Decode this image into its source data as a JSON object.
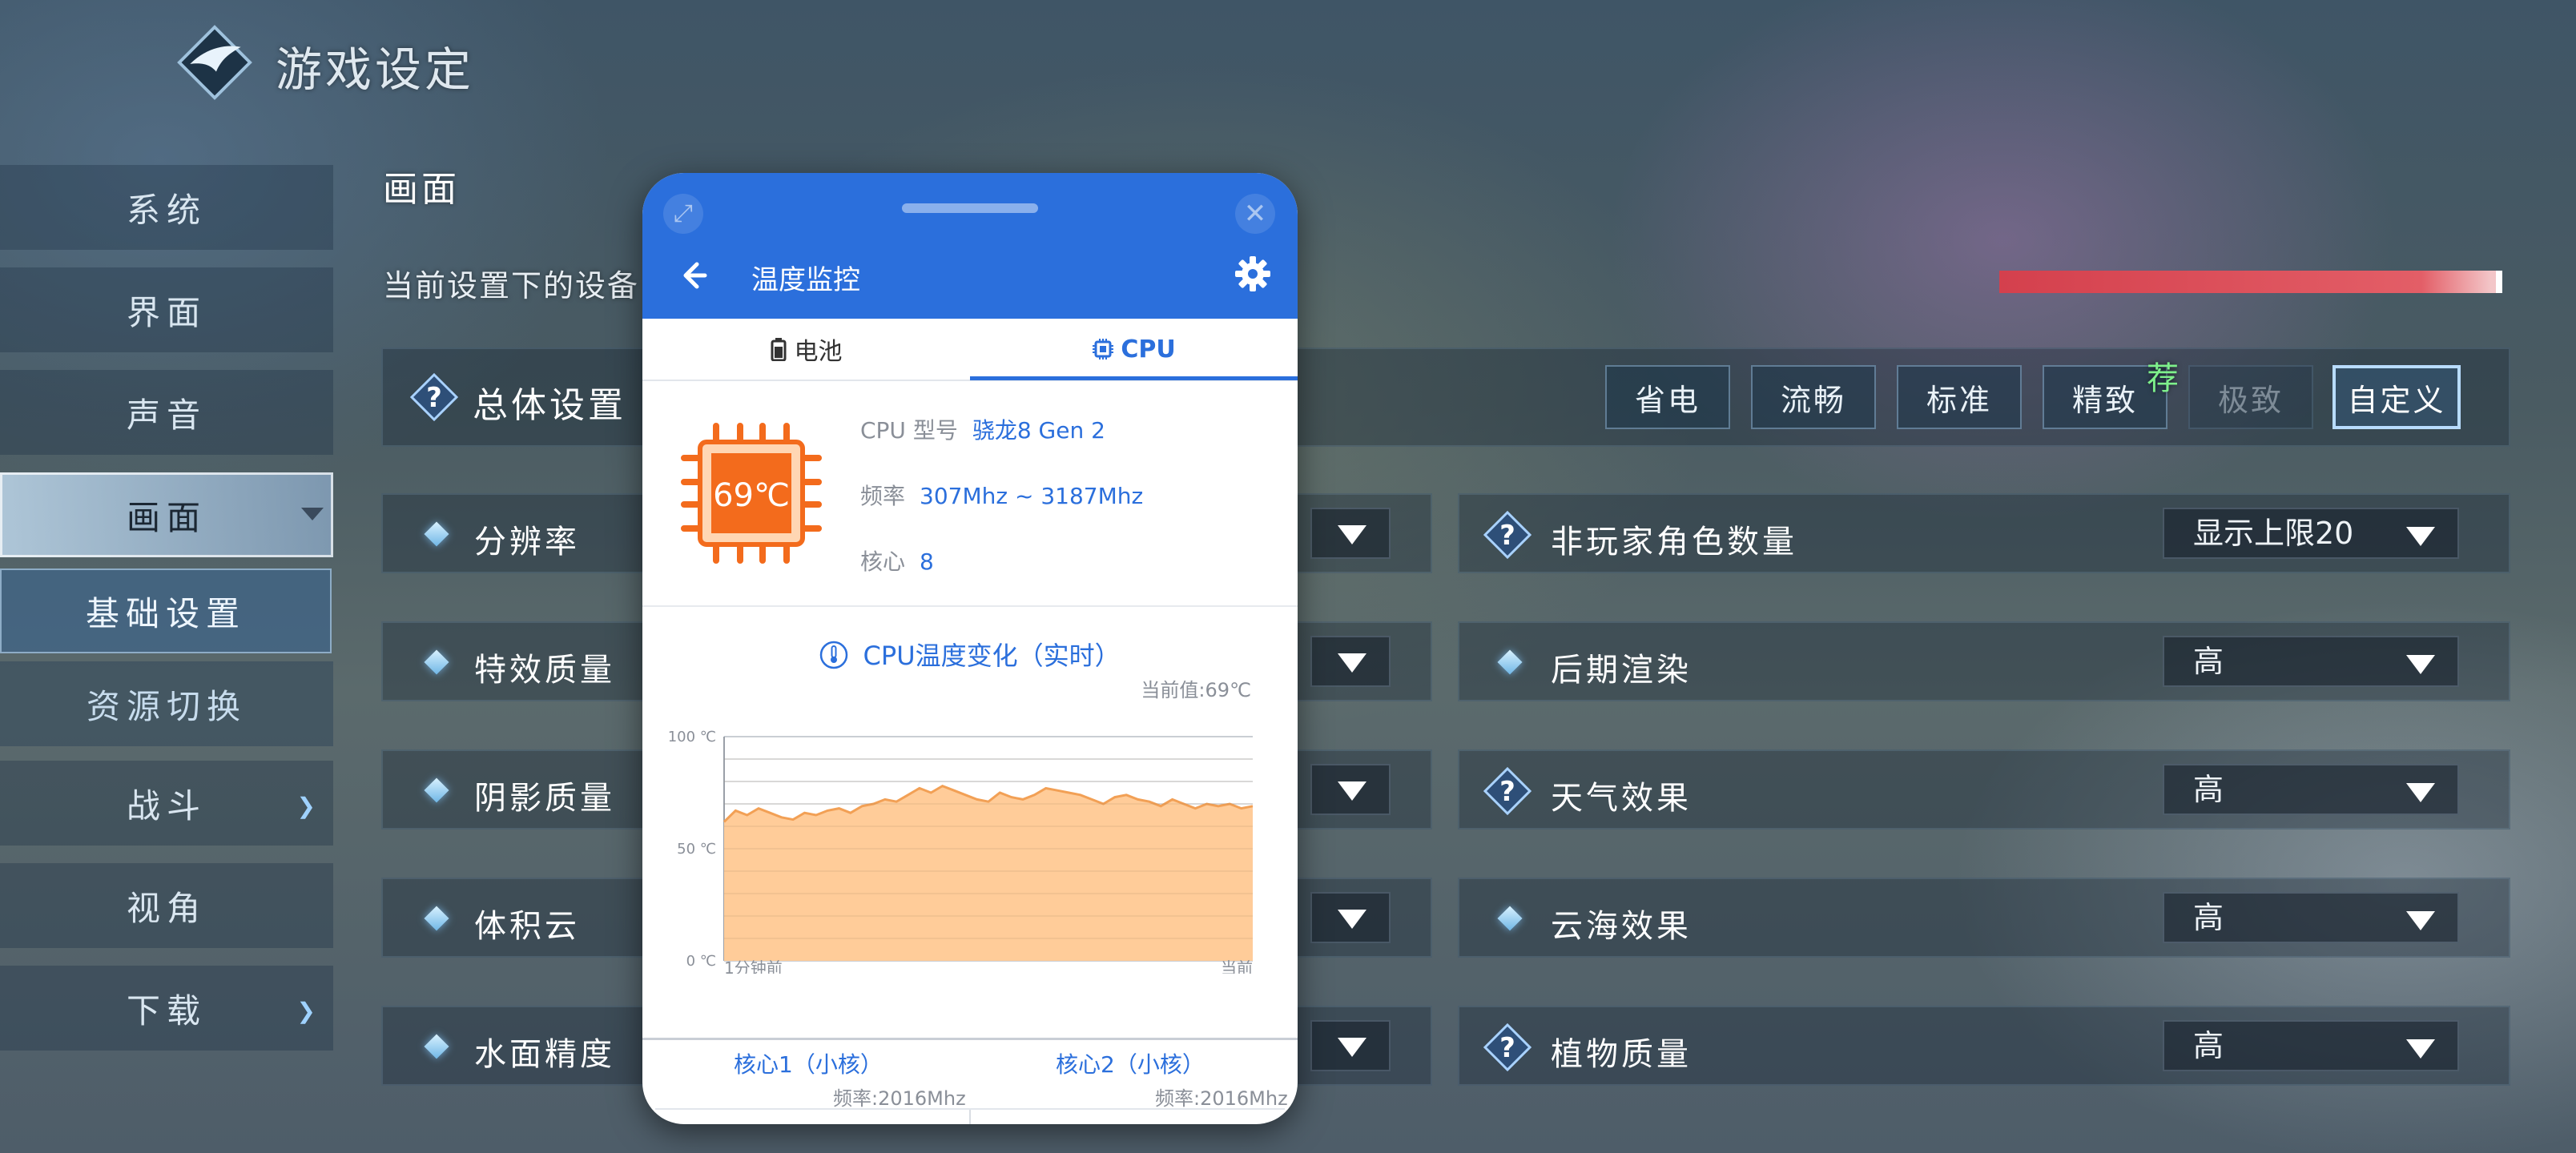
{
  "app": {
    "title": "游戏设定"
  },
  "sidebar": {
    "items": [
      {
        "label": "系统"
      },
      {
        "label": "界面"
      },
      {
        "label": "声音"
      },
      {
        "label": "画面"
      },
      {
        "label": "基础设置"
      },
      {
        "label": "资源切换"
      },
      {
        "label": "战斗"
      },
      {
        "label": "视角"
      },
      {
        "label": "下载"
      }
    ]
  },
  "main": {
    "section_title": "画面",
    "device_desc": "当前设置下的设备",
    "overall": {
      "label": "总体设置",
      "presets": [
        "省电",
        "流畅",
        "标准",
        "精致",
        "极致",
        "自定义"
      ],
      "selected": "自定义",
      "disabled": "极致",
      "recommend_badge": "荐"
    },
    "left_rows": [
      {
        "label": "分辨率"
      },
      {
        "label": "特效质量"
      },
      {
        "label": "阴影质量"
      },
      {
        "label": "体积云"
      },
      {
        "label": "水面精度"
      }
    ],
    "right_rows": [
      {
        "label": "非玩家角色数量",
        "value": "显示上限20"
      },
      {
        "label": "后期渲染",
        "value": "高"
      },
      {
        "label": "天气效果",
        "value": "高"
      },
      {
        "label": "云海效果",
        "value": "高"
      },
      {
        "label": "植物质量",
        "value": "高"
      }
    ]
  },
  "popup": {
    "title": "温度监控",
    "tabs": [
      "电池",
      "CPU"
    ],
    "active_tab": "CPU",
    "cpu_temp": "69℃",
    "model_label": "CPU 型号",
    "model_value": "骁龙8 Gen 2",
    "freq_label": "频率",
    "freq_value": "307Mhz ~ 3187Mhz",
    "cores_label": "核心",
    "cores_value": "8",
    "chart_title": "CPU温度变化（实时）",
    "current_value": "当前值:69℃",
    "cores": [
      {
        "name": "核心1（小核）",
        "freq": "频率:2016Mhz"
      },
      {
        "name": "核心2（小核）",
        "freq": "频率:2016Mhz"
      }
    ]
  },
  "colors": {
    "accent": "#2b6fdc",
    "chip": "#f36b1c",
    "area": "#ffcc99"
  },
  "chart_data": {
    "type": "area",
    "title": "CPU温度变化（实时）",
    "y_ticks": [
      "100 ℃",
      "50 ℃",
      "0 ℃"
    ],
    "ylim": [
      0,
      100
    ],
    "x_labels": [
      "1分钟前",
      "当前"
    ],
    "values": [
      62,
      67,
      65,
      68,
      66,
      64,
      63,
      66,
      65,
      67,
      68,
      66,
      69,
      70,
      72,
      71,
      74,
      77,
      75,
      78,
      76,
      74,
      72,
      71,
      75,
      73,
      72,
      74,
      77,
      76,
      75,
      74,
      72,
      70,
      73,
      74,
      72,
      71,
      69,
      72,
      70,
      68,
      70,
      69,
      70,
      68,
      69
    ]
  }
}
